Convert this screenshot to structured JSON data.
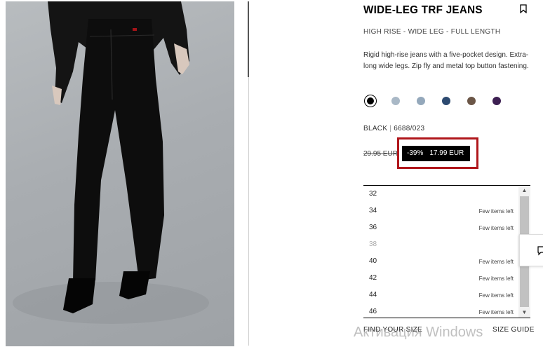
{
  "product": {
    "title": "WIDE-LEG TRF JEANS",
    "subtitle": "HIGH RISE - WIDE LEG - FULL LENGTH",
    "description": "Rigid high-rise jeans with a five-pocket design. Extra-long wide legs. Zip fly and metal top button fastening.",
    "bookmark_icon": "bookmark-icon"
  },
  "colors": [
    {
      "name": "black",
      "hex": "#000000",
      "selected": true
    },
    {
      "name": "light-grey-blue",
      "hex": "#a9b8c6",
      "selected": false
    },
    {
      "name": "grey-blue",
      "hex": "#94a8bb",
      "selected": false
    },
    {
      "name": "navy",
      "hex": "#2c4a70",
      "selected": false
    },
    {
      "name": "brown",
      "hex": "#6b5647",
      "selected": false
    },
    {
      "name": "purple",
      "hex": "#3d1f52",
      "selected": false
    }
  ],
  "color_info": {
    "color_name": "BLACK",
    "separator": "|",
    "reference": "6688/023"
  },
  "price": {
    "old": "29.95 EUR",
    "discount": "-39%",
    "current": "17.99 EUR",
    "highlight_color": "#b0161b"
  },
  "sizes": [
    {
      "size": "32",
      "availability": "",
      "disabled": false
    },
    {
      "size": "34",
      "availability": "Few items left",
      "disabled": false
    },
    {
      "size": "36",
      "availability": "Few items left",
      "disabled": false
    },
    {
      "size": "38",
      "availability": "",
      "disabled": true
    },
    {
      "size": "40",
      "availability": "Few items left",
      "disabled": false
    },
    {
      "size": "42",
      "availability": "Few items left",
      "disabled": false
    },
    {
      "size": "44",
      "availability": "Few items left",
      "disabled": false
    },
    {
      "size": "46",
      "availability": "Few items left",
      "disabled": false
    }
  ],
  "footer": {
    "find_your_size": "FIND YOUR SIZE",
    "size_guide": "SIZE GUIDE"
  },
  "watermark": "Активация Windows",
  "scrollbar": {
    "up": "▲",
    "down": "▼"
  }
}
